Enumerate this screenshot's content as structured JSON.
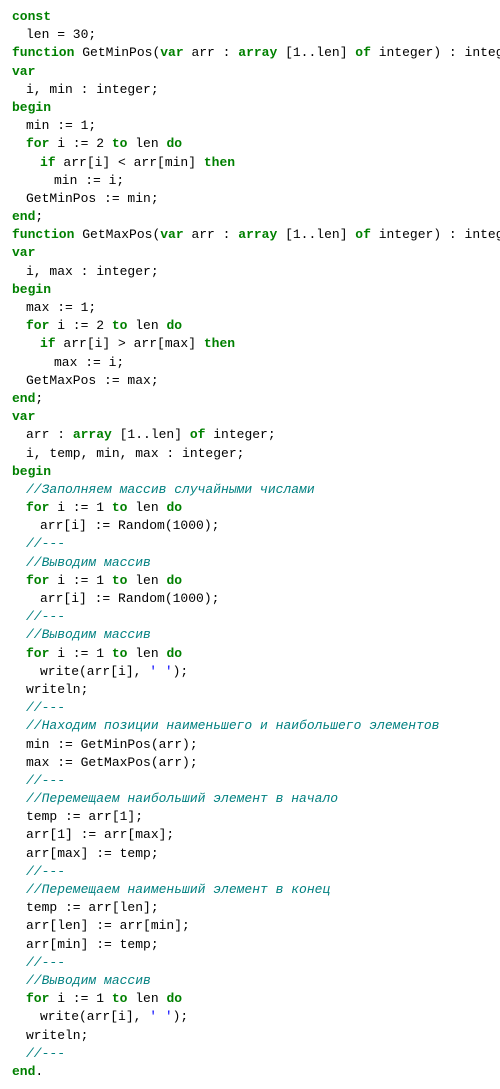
{
  "kw": {
    "const": "const",
    "function": "function",
    "var": "var",
    "arrayk": "array",
    "of": "of",
    "begin": "begin",
    "for": "for",
    "to": "to",
    "do": "do",
    "if": "if",
    "then": "then",
    "end": "end"
  },
  "l": {
    "len30": "len = 30;",
    "fn1_a": "GetMinPos(",
    "fn_arr": " arr : ",
    "fn_range": " [1..len] ",
    "fn_ofint": " integer) : integer;",
    "fn2_a": "GetMaxPos(",
    "imin": "i, min : integer;",
    "imax": "i, max : integer;",
    "min1": "min := 1;",
    "max1": "max := 1;",
    "for2len_a": " i := 2 ",
    "for1len_a": " i := 1 ",
    "tolen": " len ",
    "ifmin_a": " arr[i] < arr[min] ",
    "ifmax_a": " arr[i] > arr[max] ",
    "mini": "min := i;",
    "maxi": "max := i;",
    "retmin": "GetMinPos := min;",
    "retmax": "GetMaxPos := max;",
    "endsemi": ";",
    "enddot": ".",
    "arrdecl_a": "arr : ",
    "arrdecl_b": " [1..len] ",
    "arrdecl_c": " integer;",
    "itemp": "i, temp, min, max : integer;",
    "rand": "arr[i] := Random(1000);",
    "write_a": "write(arr[i], ",
    "write_s": "' '",
    "write_b": ");",
    "writeln": "writeln;",
    "callmin": "min := GetMinPos(arr);",
    "callmax": "max := GetMaxPos(arr);",
    "temp1": "temp := arr[1];",
    "arr1max": "arr[1] := arr[max];",
    "arrmaxtemp": "arr[max] := temp;",
    "templen": "temp := arr[len];",
    "arrlenmin": "arr[len] := arr[min];",
    "arrmintemp": "arr[min] := temp;"
  },
  "c": {
    "sep": "//---",
    "fill": "//Заполняем массив случайными числами",
    "out": "//Выводим массив",
    "find": "//Находим позиции наименьшего и наибольшего элементов",
    "movemax": "//Перемещаем наибольший элемент в начало",
    "movemin": "//Перемещаем наименьший элемент в конец"
  }
}
